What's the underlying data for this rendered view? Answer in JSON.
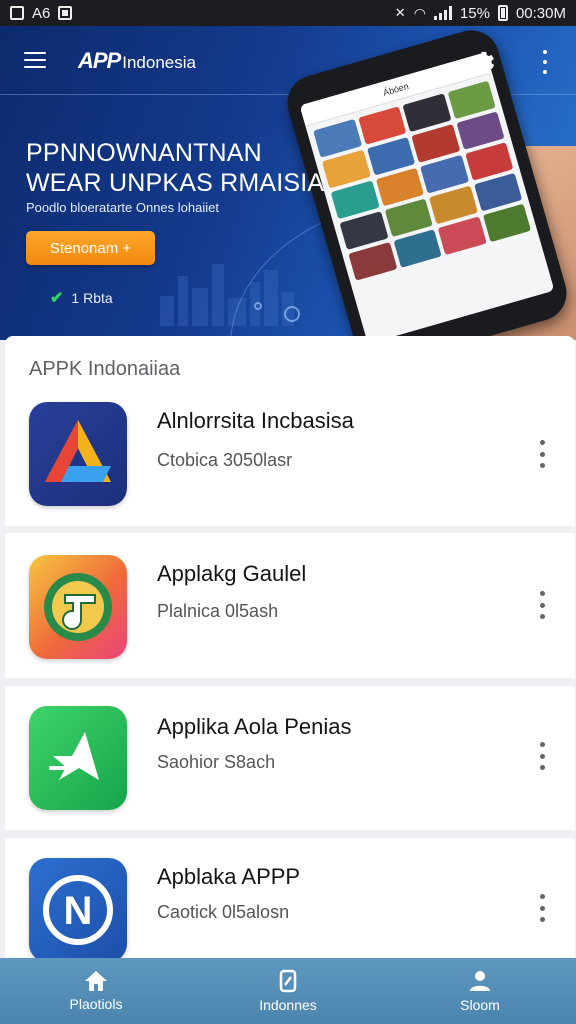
{
  "status_bar": {
    "left_text": "A6",
    "battery": "15%",
    "time": "00:30M"
  },
  "header": {
    "brand_main": "APP",
    "brand_sub": "Indonesia"
  },
  "hero": {
    "headline_1": "PPNNOWNANTNAN",
    "headline_2": "WEAR UNPKAS RMAISIA",
    "subline": "Poodlo bloeratarte Onnes lohaiiet",
    "cta_label": "Stenonam +",
    "rating_text": "1 Rbta",
    "phone_title": "Ábóen"
  },
  "list": {
    "section_title": "APPK Indonaiiaa",
    "apps": [
      {
        "name": "Alnlorrsita Incbasisa",
        "meta": "Ctobica 3050lasr",
        "icon": "triangle-logo-icon"
      },
      {
        "name": "Applakg Gaulel",
        "meta": "Plalnica 0l5ash",
        "icon": "music-note-icon"
      },
      {
        "name": "Applika Aola Penias",
        "meta": "Saohior S8ach",
        "icon": "paper-plane-icon"
      },
      {
        "name": "Apblaka APPP",
        "meta": "Caotick 0l5alosn",
        "icon": "n-circle-icon"
      }
    ]
  },
  "bottom_nav": [
    {
      "label": "Plaotiols",
      "icon": "home-icon"
    },
    {
      "label": "Indonnes",
      "icon": "phone-share-icon"
    },
    {
      "label": "Sloom",
      "icon": "user-icon"
    }
  ],
  "colors": {
    "accent": "#f39414",
    "hero_blue": "#143a8c",
    "nav_blue": "#5a93ba"
  }
}
